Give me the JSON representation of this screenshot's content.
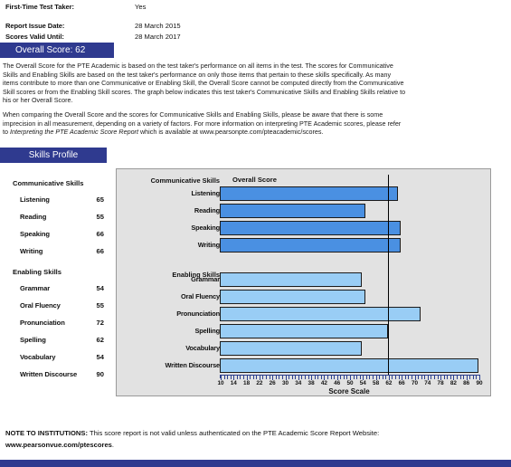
{
  "meta": {
    "first_time_label": "First-Time Test Taker:",
    "first_time_value": "Yes",
    "issue_date_label": "Report Issue Date:",
    "issue_date_value": "28 March 2015",
    "valid_until_label": "Scores Valid Until:",
    "valid_until_value": "28 March 2017"
  },
  "overall": {
    "banner": "Overall Score: 62",
    "score": 62,
    "paragraph_1": "The Overall Score for the PTE Academic is based on the test taker's performance on all items in the test.  The scores for Communicative Skills and Enabling Skills are based on the test taker's performance on only those items that pertain to these skills specifically.  As many items contribute to more than one Communicative or Enabling Skill, the Overall Score cannot be computed directly from the Communicative Skill scores or from the Enabling Skill scores.  The graph below indicates this test taker's Communicative Skills and Enabling Skills relative to his or her Overall Score.",
    "paragraph_2_part1": "When comparing the Overall Score and the scores for Communicative Skills and Enabling Skills, please be aware that there is some imprecision in all measurement, depending on a variety of factors.  For more information on interpreting PTE Academic scores, please refer to ",
    "paragraph_2_italic": "Interpreting the PTE Academic Score Report",
    "paragraph_2_part2": " which is available at www.pearsonpte.com/pteacademic/scores."
  },
  "skills_profile": {
    "banner": "Skills Profile",
    "communicative_title": "Communicative Skills",
    "enabling_title": "Enabling Skills",
    "communicative": [
      {
        "name": "Listening",
        "score": 65
      },
      {
        "name": "Reading",
        "score": 55
      },
      {
        "name": "Speaking",
        "score": 66
      },
      {
        "name": "Writing",
        "score": 66
      }
    ],
    "enabling": [
      {
        "name": "Grammar",
        "score": 54
      },
      {
        "name": "Oral Fluency",
        "score": 55
      },
      {
        "name": "Pronunciation",
        "score": 72
      },
      {
        "name": "Spelling",
        "score": 62
      },
      {
        "name": "Vocabulary",
        "score": 54
      },
      {
        "name": "Written Discourse",
        "score": 90
      }
    ]
  },
  "chart_data": {
    "type": "bar",
    "orientation": "horizontal",
    "title": "Skills Profile",
    "overall_score_label": "Overall Score",
    "overall_score_line": 62,
    "xlabel": "Score Scale",
    "ylabel": "",
    "xlim": [
      10,
      90
    ],
    "xticks": [
      10,
      14,
      18,
      22,
      26,
      30,
      34,
      38,
      42,
      46,
      50,
      54,
      58,
      62,
      66,
      70,
      74,
      78,
      82,
      86,
      90
    ],
    "minor_tick_step": 1,
    "grid": false,
    "legend": "none",
    "group_headers": [
      "Communicative Skills",
      "Enabling Skills"
    ],
    "series": [
      {
        "name": "Communicative Skills",
        "color": "#4a90e2",
        "categories": [
          "Listening",
          "Reading",
          "Speaking",
          "Writing"
        ],
        "values": [
          65,
          55,
          66,
          66
        ]
      },
      {
        "name": "Enabling Skills",
        "color": "#99cdf5",
        "categories": [
          "Grammar",
          "Oral Fluency",
          "Pronunciation",
          "Spelling",
          "Vocabulary",
          "Written Discourse"
        ],
        "values": [
          54,
          55,
          72,
          62,
          54,
          90
        ]
      }
    ]
  },
  "footer": {
    "note_bold": "NOTE TO INSTITUTIONS:",
    "note_text_1": " This score report is not valid unless authenticated on the PTE Academic Score Report Website: ",
    "note_site": "www.pearsonvue.com/ptescores",
    "note_text_2": "."
  },
  "colors": {
    "banner_navy": "#2f3a8f",
    "communicative_bar": "#4a90e2",
    "enabling_bar": "#99cdf5",
    "chart_background": "#e2e2e2",
    "axis_blue": "#2b3f8f"
  }
}
